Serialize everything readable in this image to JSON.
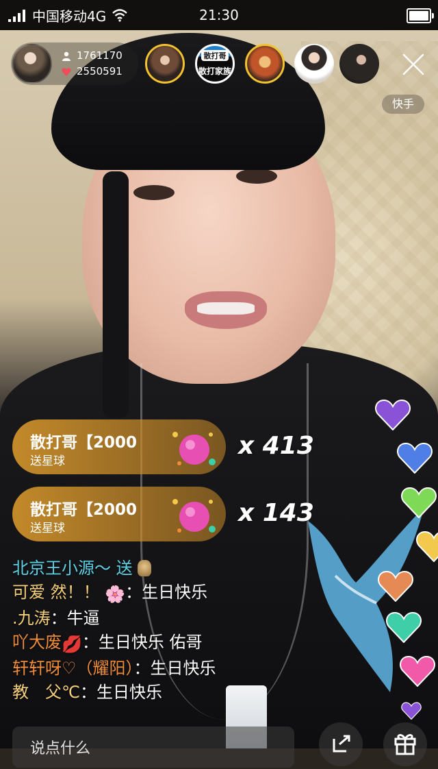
{
  "status_bar": {
    "carrier": "中国移动4G",
    "time": "21:30"
  },
  "host": {
    "followers": "1761170",
    "likes": "2550591"
  },
  "viewers": {
    "badge_text_top": "散打哥",
    "badge_text_bottom": "散打家族"
  },
  "brand_label": "快手",
  "gifts": [
    {
      "title": "散打哥【2000",
      "subtitle": "送星球",
      "count": "x 413"
    },
    {
      "title": "散打哥【2000",
      "subtitle": "送星球",
      "count": "x 143"
    }
  ],
  "chat": [
    {
      "user": "北京王小源～",
      "message": "送",
      "user_color": "#5ed3e8",
      "has_gift_icon": true
    },
    {
      "user": "可爱 然！！",
      "emoji": "🌸",
      "sep": "：",
      "message": "生日快乐",
      "user_color": "#f5cf7a"
    },
    {
      "user": ".九涛",
      "sep": "：",
      "message": "牛逼",
      "user_color": "#f5cf7a"
    },
    {
      "user": "吖大废",
      "emoji": "💋",
      "sep": "：",
      "message": "生日快乐 佑哥",
      "user_color": "#f08d3a"
    },
    {
      "user": "轩轩呀♡（耀阳）",
      "sep": "：",
      "message": "生日快乐",
      "user_color": "#f08d3a"
    },
    {
      "user": "教　父℃",
      "sep": "：",
      "message": "生日快乐",
      "user_color": "#f5cf7a"
    }
  ],
  "input": {
    "placeholder": "说点什么"
  },
  "icons": {
    "followers": "person-icon",
    "likes": "heart-icon",
    "close": "close-icon",
    "share": "share-icon",
    "gift": "gift-icon"
  },
  "colors": {
    "gift_banner": "#d6962c",
    "heart_colors": [
      "#8a52d6",
      "#4f7ee6",
      "#7ed957",
      "#f2c94c",
      "#e68a55",
      "#3ecfa8",
      "#f05aa8",
      "#8a52d6"
    ]
  }
}
